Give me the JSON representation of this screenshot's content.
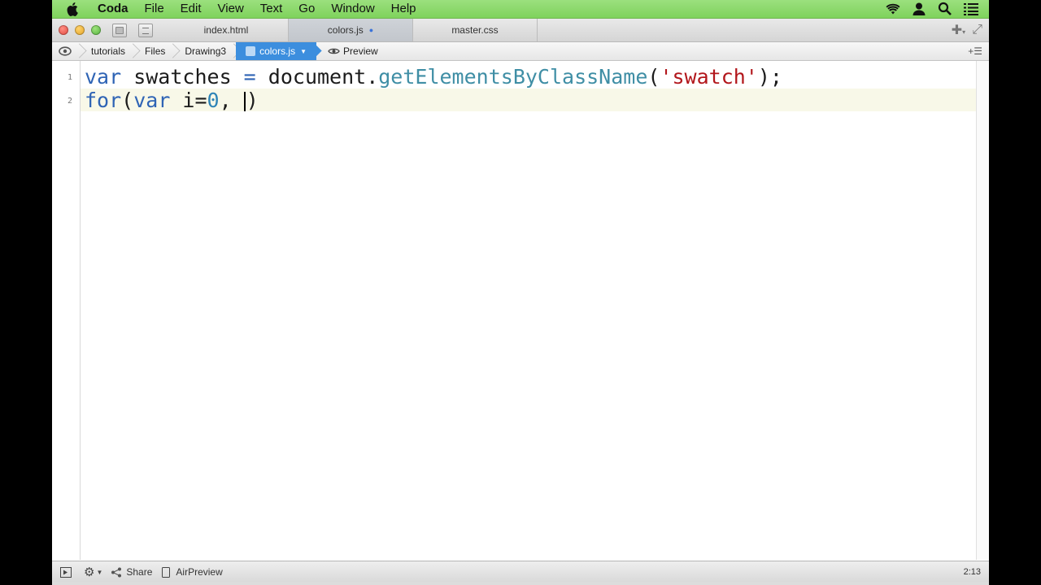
{
  "menubar": {
    "app_name": "Coda",
    "items": [
      "File",
      "Edit",
      "View",
      "Text",
      "Go",
      "Window",
      "Help"
    ],
    "status_icons": [
      "wifi-icon",
      "user-icon",
      "spotlight-icon",
      "notification-list-icon"
    ]
  },
  "tabs": [
    {
      "label": "index.html",
      "active": false
    },
    {
      "label": "colors.js",
      "active": true,
      "modified": true
    },
    {
      "label": "master.css",
      "active": false
    }
  ],
  "breadcrumb": {
    "items": [
      "tutorials",
      "Files",
      "Drawing3",
      "colors.js"
    ],
    "preview_label": "Preview"
  },
  "editor": {
    "line_numbers": [
      "1",
      "2"
    ],
    "line1": {
      "kw1": "var",
      "t1": " swatches ",
      "op": "=",
      "t2": " document.",
      "fn": "getElementsByClassName",
      "t3": "(",
      "str": "'swatch'",
      "t4": ");"
    },
    "line2": {
      "kw1": "for",
      "t1": "(",
      "kw2": "var",
      "t2": " i=",
      "num": "0",
      "t3": ", ",
      "t4": ")"
    }
  },
  "statusbar": {
    "share_label": "Share",
    "airpreview_label": "AirPreview",
    "cursor_position": "2:13"
  },
  "colors": {
    "menubar": "#8ed96c",
    "breadcrumb_active": "#3c8ede",
    "keyword": "#2f64b5",
    "string": "#b2161b"
  }
}
